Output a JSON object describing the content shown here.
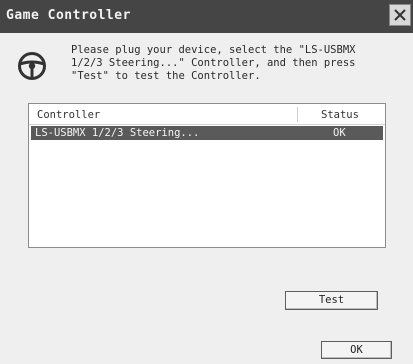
{
  "window": {
    "title": "Game Controller",
    "close_icon": "close-icon"
  },
  "message": {
    "icon": "steering-wheel-icon",
    "text": "Please plug your device, select the \"LS-USBMX\n1/2/3 Steering...\" Controller, and then press\n\"Test\" to test the Controller."
  },
  "list": {
    "columns": [
      "Controller",
      "Status"
    ],
    "rows": [
      {
        "controller": "LS-USBMX 1/2/3 Steering...",
        "status": "OK"
      }
    ]
  },
  "buttons": {
    "test_label": "Test",
    "ok_label": "OK"
  }
}
